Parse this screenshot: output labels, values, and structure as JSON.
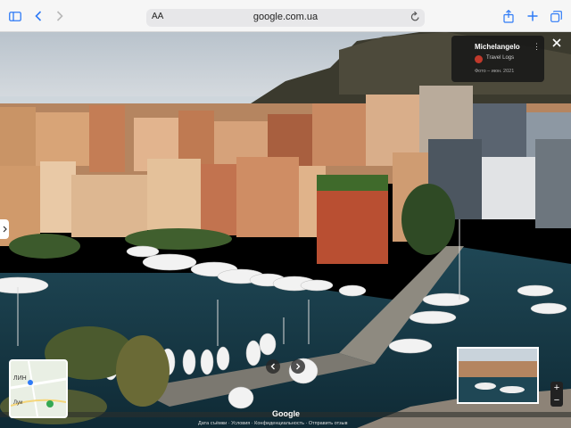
{
  "browser": {
    "reader_aa": "AA",
    "url": "google.com.ua"
  },
  "icons": {
    "sidebar": "sidebar-icon",
    "back": "chevron-left-icon",
    "forward": "chevron-right-icon",
    "reload": "reload-icon",
    "share": "share-icon",
    "new_tab": "plus-icon",
    "tabs": "tabs-icon",
    "close": "close-icon",
    "menu": "kebab-menu-icon"
  },
  "info_card": {
    "title": "Michelangelo",
    "source": "Travel Logs",
    "date": "Фото – июн. 2021"
  },
  "minimap": {
    "label_top": "ЛИН",
    "label_bottom": "Луи"
  },
  "zoom": {
    "plus": "+",
    "minus": "−"
  },
  "google_logo": "Google",
  "footer": "Дата съёмки · Условия · Конфиденциальность · Отправить отзыв",
  "colors": {
    "accent": "#2f7bf6",
    "water": "#1a3c4a",
    "sky": "#d8e0e6",
    "buildings": "#c9874f",
    "hillside": "#3b3a2e",
    "card_bg": "#181818"
  }
}
